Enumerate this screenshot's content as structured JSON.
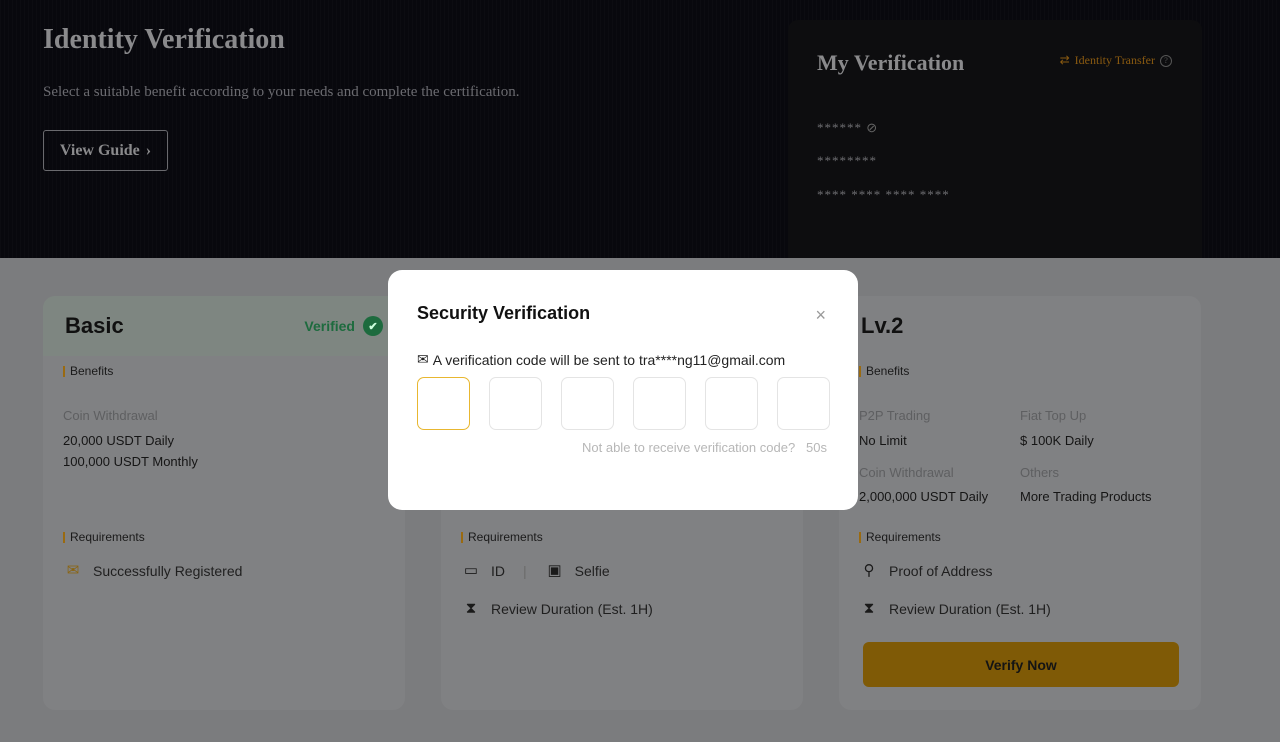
{
  "hero": {
    "title": "Identity Verification",
    "subtitle": "Select a suitable benefit according to your needs and complete the certification.",
    "guide_label": "View Guide"
  },
  "my_verification": {
    "title": "My Verification",
    "transfer_label": "Identity Transfer",
    "name_mask": "******",
    "id_mask": "********",
    "number_mask": "**** **** **** ****"
  },
  "cards": [
    {
      "title": "Basic",
      "status": "Verified",
      "benefits_label": "Benefits",
      "benefit_name": "Coin Withdrawal",
      "benefit_values": [
        "20,000 USDT Daily",
        "100,000 USDT Monthly"
      ],
      "requirements_label": "Requirements",
      "requirements": [
        "Successfully Registered"
      ]
    },
    {
      "requirements_label": "Requirements",
      "requirements": [
        "ID",
        "Selfie"
      ],
      "review": "Review Duration (Est. 1H)"
    },
    {
      "title": "Lv.2",
      "benefits_label": "Benefits",
      "benefits": [
        {
          "name": "P2P Trading",
          "value": "No Limit"
        },
        {
          "name": "Fiat Top Up",
          "value": "$ 100K Daily"
        },
        {
          "name": "Coin Withdrawal",
          "value": "2,000,000 USDT Daily"
        },
        {
          "name": "Others",
          "value": "More Trading Products"
        }
      ],
      "requirements_label": "Requirements",
      "requirements": [
        "Proof of Address"
      ],
      "review": "Review Duration (Est. 1H)",
      "action": "Verify Now"
    }
  ],
  "modal": {
    "title": "Security Verification",
    "info": "A verification code will be sent to tra****ng11@gmail.com",
    "code_digits": [
      "",
      "",
      "",
      "",
      "",
      ""
    ],
    "resend": "Not able to receive verification code?",
    "countdown": "50s"
  },
  "colors": {
    "accent": "#e8b730",
    "verified": "#1d6b3e"
  }
}
